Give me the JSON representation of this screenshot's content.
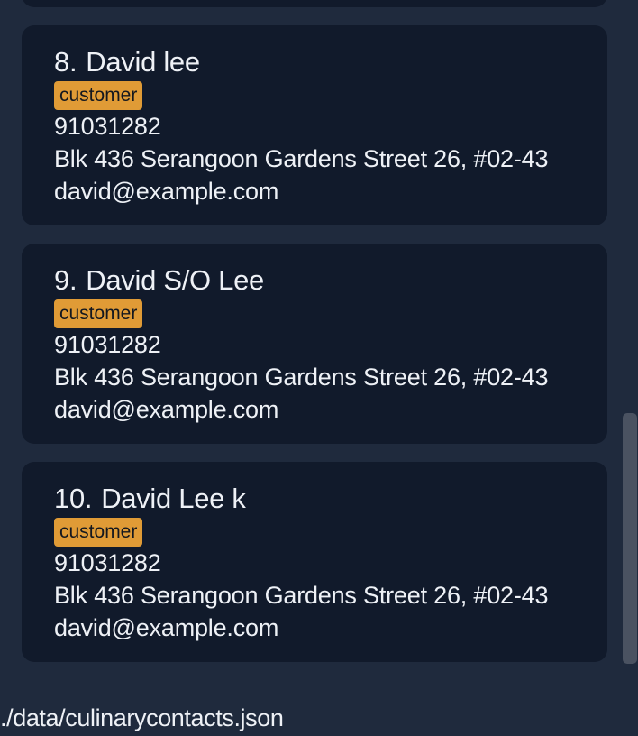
{
  "contacts": [
    {
      "index": "8.",
      "name": "David lee",
      "tag": "customer",
      "phone": "91031282",
      "address": "Blk 436 Serangoon Gardens Street 26, #02-43",
      "email": "david@example.com"
    },
    {
      "index": "9.",
      "name": "David S/O Lee",
      "tag": "customer",
      "phone": "91031282",
      "address": "Blk 436 Serangoon Gardens Street 26, #02-43",
      "email": "david@example.com"
    },
    {
      "index": "10.",
      "name": "David Lee k",
      "tag": "customer",
      "phone": "91031282",
      "address": "Blk 436 Serangoon Gardens Street 26, #02-43",
      "email": "david@example.com"
    }
  ],
  "status_bar": {
    "file_path": "./data/culinarycontacts.json"
  },
  "colors": {
    "background": "#1f2a3d",
    "card": "#111a2b",
    "tag": "#e09b36",
    "text": "#eef1f6",
    "scrollbar_thumb": "#4a5261"
  }
}
